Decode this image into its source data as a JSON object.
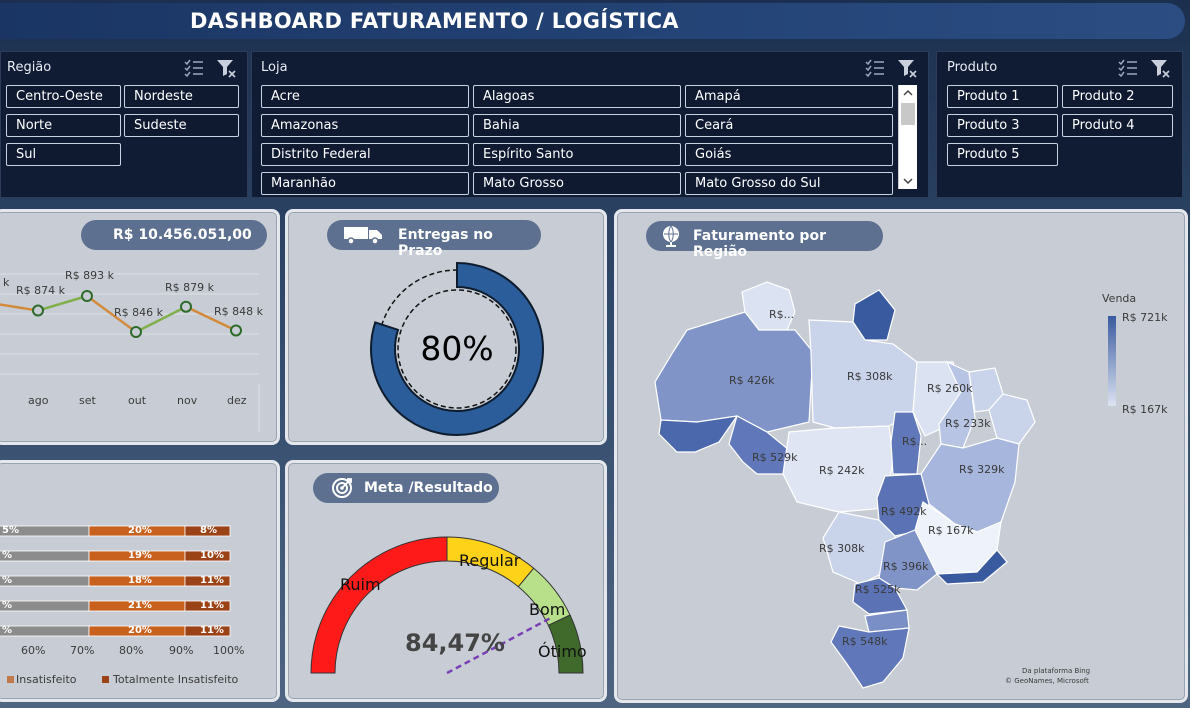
{
  "header": {
    "title": "DASHBOARD FATURAMENTO / LOGÍSTICA"
  },
  "slicers": {
    "regiao": {
      "title": "Região",
      "items": [
        "Centro-Oeste",
        "Nordeste",
        "Norte",
        "Sudeste",
        "Sul"
      ]
    },
    "loja": {
      "title": "Loja",
      "items": [
        "Acre",
        "Alagoas",
        "Amapá",
        "Amazonas",
        "Bahia",
        "Ceará",
        "Distrito Federal",
        "Espírito Santo",
        "Goiás",
        "Maranhão",
        "Mato Grosso",
        "Mato Grosso do Sul"
      ]
    },
    "produto": {
      "title": "Produto",
      "items": [
        "Produto 1",
        "Produto 2",
        "Produto 3",
        "Produto 4",
        "Produto 5"
      ]
    }
  },
  "revenue": {
    "total": "R$ 10.456.051,00",
    "months": [
      "ago",
      "set",
      "out",
      "nov",
      "dez"
    ],
    "point_labels": [
      "R$ 874 k",
      "R$ 893 k",
      "R$ 846 k",
      "R$ 879 k",
      "R$ 848 k"
    ],
    "partial_label": "k",
    "values_k": [
      874,
      893,
      846,
      879,
      848
    ]
  },
  "deliveries": {
    "title": "Entregas no Prazo",
    "value_text": "80%",
    "value": 0.8
  },
  "goal": {
    "title": "Meta /Resultado",
    "value_text": "84,47%",
    "value": 0.8447,
    "zones": [
      "Ruim",
      "Regular",
      "Bom",
      "Ótimo"
    ]
  },
  "satisfaction": {
    "rows": [
      {
        "left": "5%",
        "mid": "20%",
        "right": "8%"
      },
      {
        "left": "%",
        "mid": "19%",
        "right": "10%"
      },
      {
        "left": "%",
        "mid": "18%",
        "right": "11%"
      },
      {
        "left": "%",
        "mid": "21%",
        "right": "11%"
      },
      {
        "left": "%",
        "mid": "20%",
        "right": "11%"
      }
    ],
    "axis": [
      "60%",
      "70%",
      "80%",
      "90%",
      "100%"
    ],
    "legend": [
      "Insatisfeito",
      "Totalmente Insatisfeito"
    ],
    "colors": {
      "grey": "#8c8c8c",
      "orange": "#c8601e",
      "dark": "#9b4316"
    }
  },
  "map": {
    "title": "Faturamento por Região",
    "legend_title": "Venda",
    "legend_max": "R$ 721k",
    "legend_min": "R$ 167k",
    "labels": [
      "R$...",
      "R$ 426k",
      "R$ 308k",
      "R$ 260k",
      "R$ 233k",
      "R$...",
      "R$ 529k",
      "R$ 242k",
      "R$ 329k",
      "R$ 492k",
      "R$ 167k",
      "R$ 308k",
      "R$ 396k",
      "R$ 525k",
      "R$ 548k"
    ],
    "credit_1": "Da plataforma Bing",
    "credit_2": "© GeoNames, Microsoft",
    "colors": {
      "low": "#dce3f1",
      "high": "#3a5aa0"
    }
  }
}
